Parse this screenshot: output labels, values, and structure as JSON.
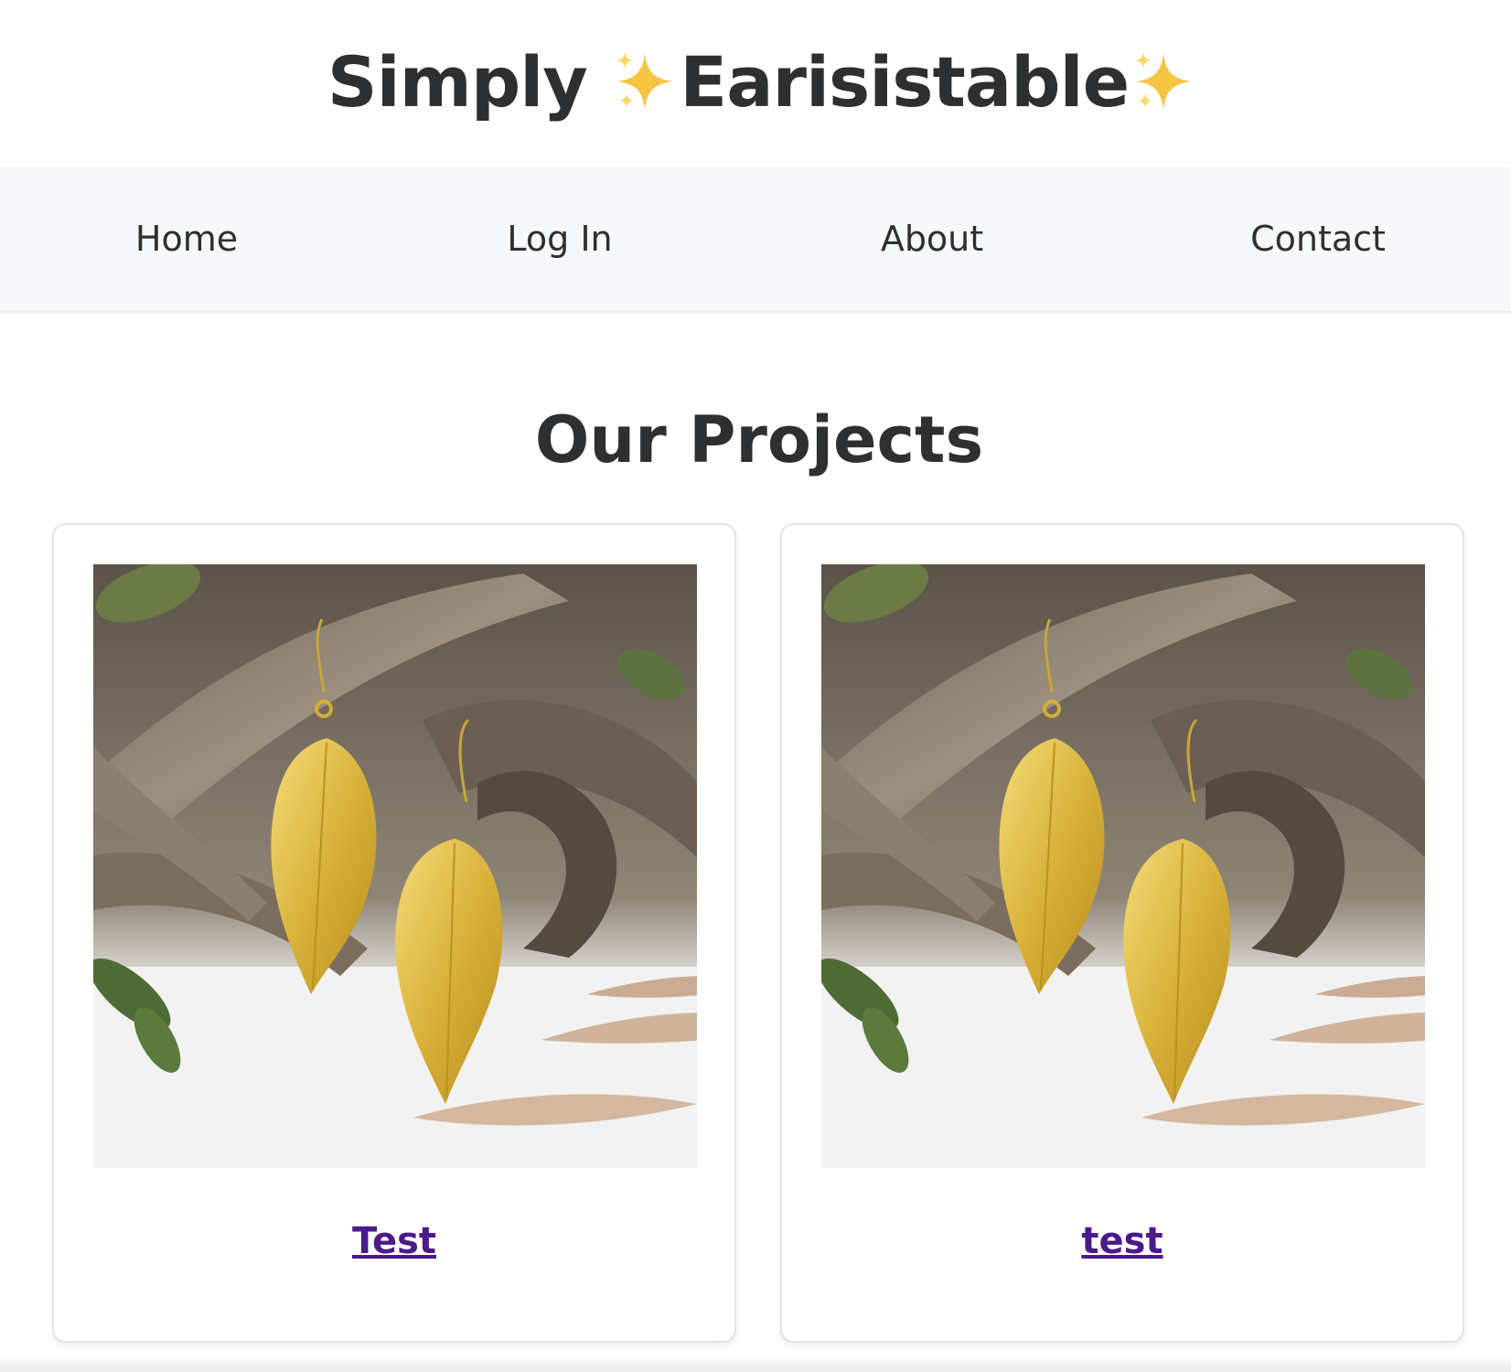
{
  "header": {
    "title_part1": "Simply ",
    "title_part2": "Earisistable",
    "sparkle_icon": "sparkles-emoji"
  },
  "nav": {
    "items": [
      {
        "label": "Home"
      },
      {
        "label": "Log In"
      },
      {
        "label": "About"
      },
      {
        "label": "Contact"
      }
    ]
  },
  "main": {
    "section_title": "Our Projects",
    "projects": [
      {
        "title": "Test",
        "image": "gold-leaf-earrings-photo"
      },
      {
        "title": "test",
        "image": "gold-leaf-earrings-photo"
      }
    ]
  },
  "colors": {
    "text": "#2d2f31",
    "nav_background": "#f7f8f9",
    "link": "#4a1a8c",
    "sparkle": "#f5c542"
  }
}
